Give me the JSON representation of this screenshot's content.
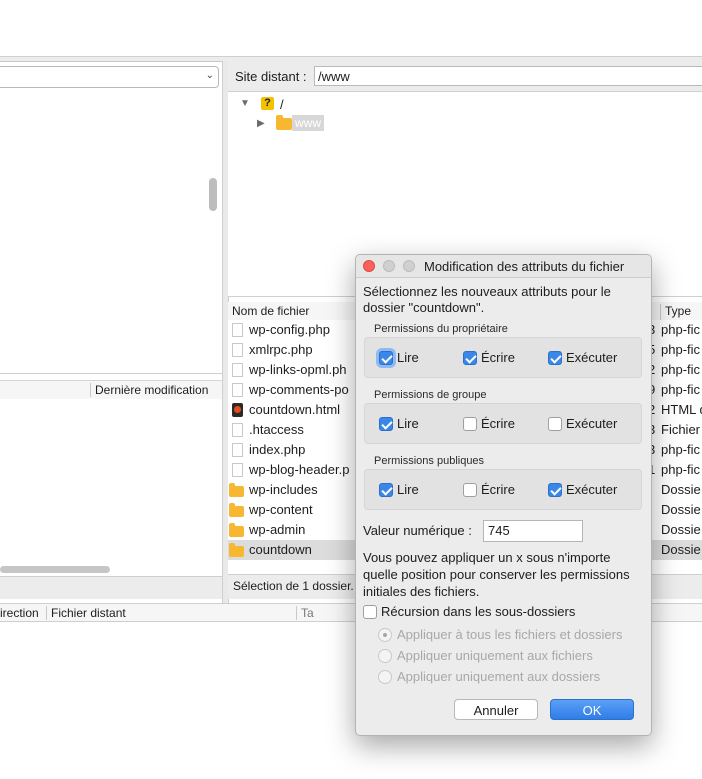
{
  "remote": {
    "label": "Site distant :",
    "path": "/www",
    "tree": {
      "root": "/",
      "child": "www"
    }
  },
  "left_list": {
    "col_modified": "Dernière modification"
  },
  "file_list": {
    "col_name": "Nom de fichier",
    "col_type": "Type de",
    "rows": [
      {
        "name": "wp-config.php",
        "size": "3",
        "type": "php-fic",
        "icon": "file"
      },
      {
        "name": "xmlrpc.php",
        "size": "5",
        "type": "php-fic",
        "icon": "file"
      },
      {
        "name": "wp-links-opml.ph",
        "size": "2",
        "type": "php-fic",
        "icon": "file"
      },
      {
        "name": "wp-comments-po",
        "size": "9",
        "type": "php-fic",
        "icon": "file"
      },
      {
        "name": "countdown.html",
        "size": "2",
        "type": "HTML d",
        "icon": "html"
      },
      {
        "name": ".htaccess",
        "size": "3",
        "type": "Fichier",
        "icon": "file"
      },
      {
        "name": "index.php",
        "size": "3",
        "type": "php-fic",
        "icon": "file"
      },
      {
        "name": "wp-blog-header.p",
        "size": "1",
        "type": "php-fic",
        "icon": "file"
      },
      {
        "name": "wp-includes",
        "size": "",
        "type": "Dossie",
        "icon": "folder"
      },
      {
        "name": "wp-content",
        "size": "",
        "type": "Dossie",
        "icon": "folder"
      },
      {
        "name": "wp-admin",
        "size": "",
        "type": "Dossie",
        "icon": "folder"
      },
      {
        "name": "countdown",
        "size": "",
        "type": "Dossie",
        "icon": "folder",
        "selected": true
      }
    ]
  },
  "status": {
    "right": "Sélection de 1 dossier."
  },
  "queue": {
    "col_direction": "irection",
    "col_remote": "Fichier distant",
    "col_ta": "Ta"
  },
  "dialog": {
    "title": "Modification des attributs du fichier",
    "intro": "Sélectionnez les nouveaux attributs pour le dossier \"countdown\".",
    "groups": [
      {
        "title": "Permissions du propriétaire",
        "read": true,
        "write": true,
        "exec": true
      },
      {
        "title": "Permissions de groupe",
        "read": true,
        "write": false,
        "exec": false
      },
      {
        "title": "Permissions publiques",
        "read": true,
        "write": false,
        "exec": true
      }
    ],
    "labels": {
      "read": "Lire",
      "write": "Écrire",
      "exec": "Exécuter"
    },
    "numeric_label": "Valeur numérique :",
    "numeric_value": "745",
    "hint": "Vous pouvez appliquer un x sous n'importe quelle position pour conserver les permissions initiales des fichiers.",
    "recurse_label": "Récursion dans les sous-dossiers",
    "recurse_checked": false,
    "radios": [
      {
        "label": "Appliquer à tous les fichiers et dossiers",
        "selected": true
      },
      {
        "label": "Appliquer uniquement aux fichiers",
        "selected": false
      },
      {
        "label": "Appliquer uniquement aux dossiers",
        "selected": false
      }
    ],
    "cancel_label": "Annuler",
    "ok_label": "OK"
  }
}
